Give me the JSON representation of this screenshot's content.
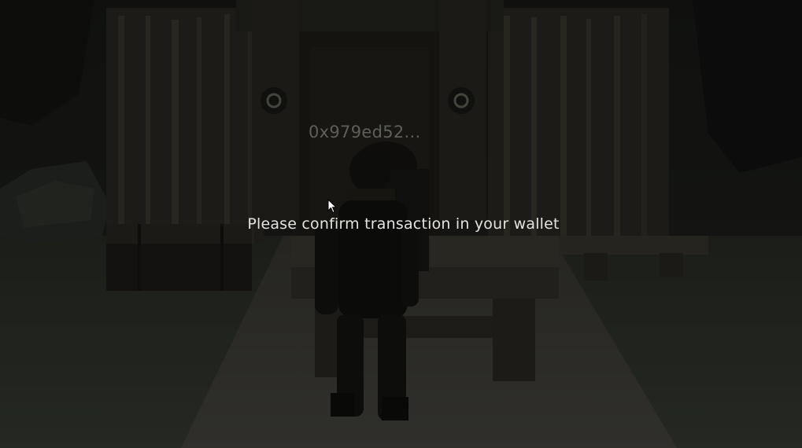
{
  "player": {
    "wallet_address": "0x979ed52..."
  },
  "modal": {
    "message": "Please confirm transaction in your wallet"
  },
  "icons": {
    "banner_emblem": "ram-emblem-icon",
    "cursor": "mouse-pointer-icon"
  },
  "colors": {
    "message_text": "#e4e4df",
    "nameplate_text": "#5e5f56"
  }
}
